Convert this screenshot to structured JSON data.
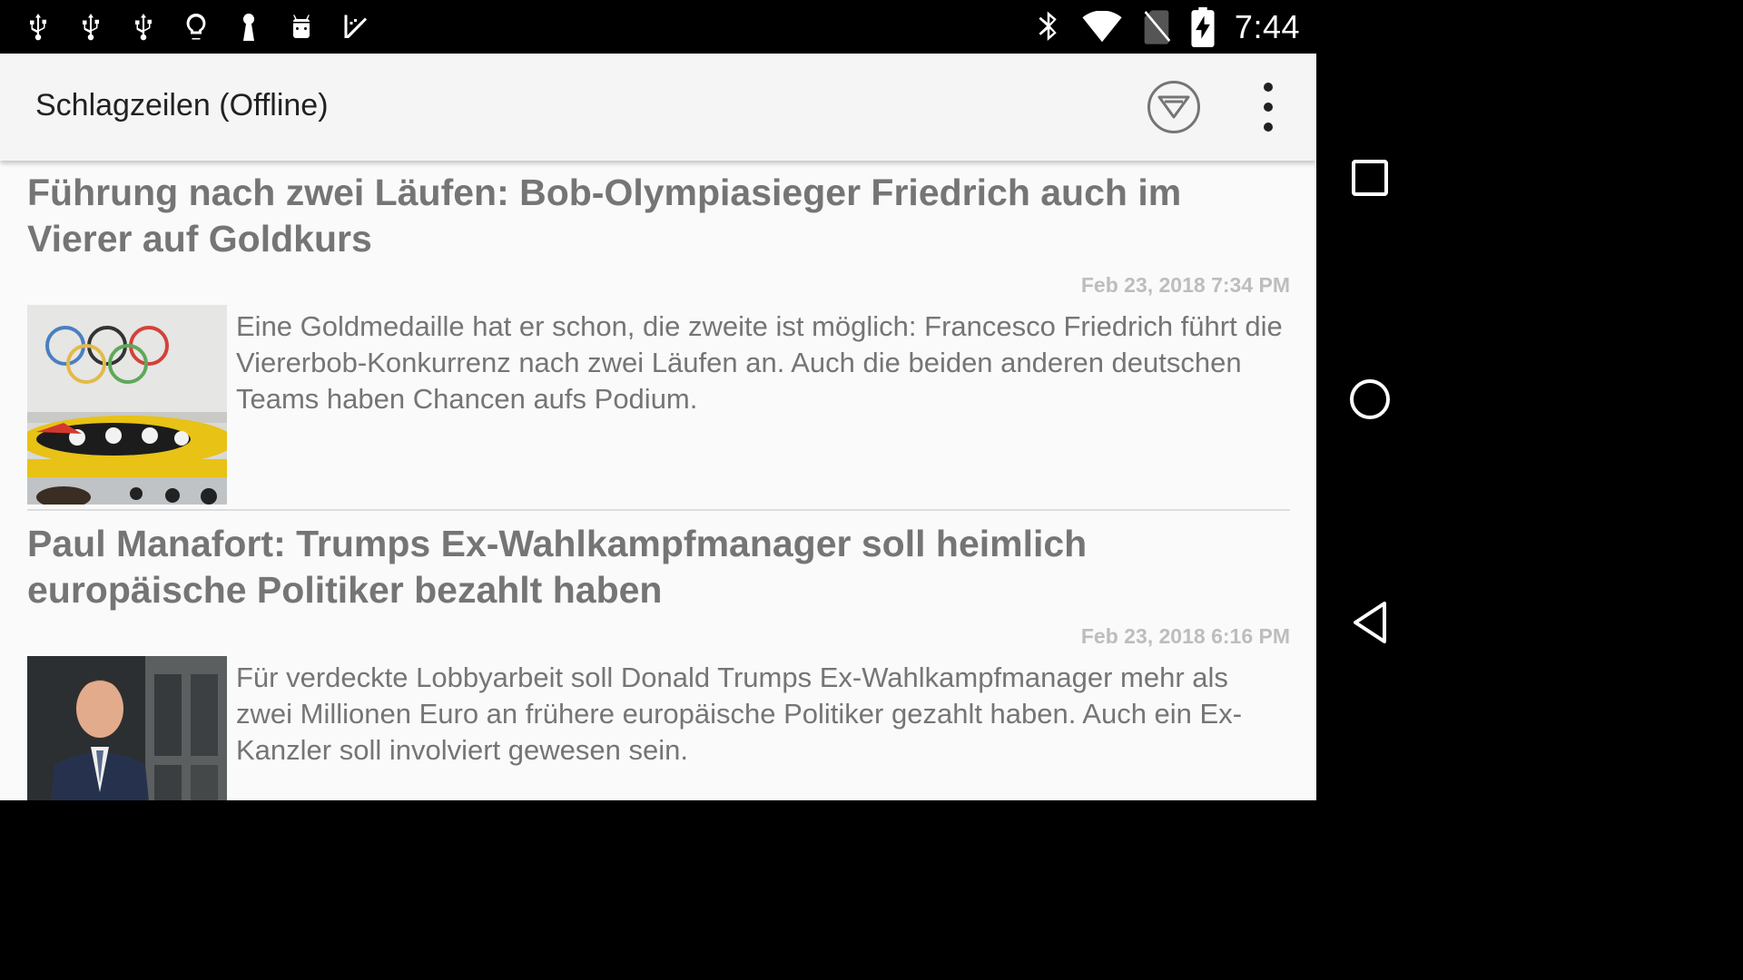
{
  "status_bar": {
    "notification_icons": [
      "usb-icon",
      "usb-icon",
      "usb-icon",
      "lightbulb-icon",
      "keyhole-icon",
      "android-icon",
      "checklist-icon"
    ],
    "system_icons": [
      "bluetooth-icon",
      "wifi-icon",
      "no-sim-icon",
      "battery-charging-icon"
    ],
    "time": "7:44"
  },
  "app_bar": {
    "title": "Schlagzeilen (Offline)",
    "filter_icon": "filter-icon",
    "overflow_icon": "more-vert-icon"
  },
  "articles": [
    {
      "headline": "Führung nach zwei Läufen: Bob-Olympiasieger Friedrich auch im Vierer auf Goldkurs",
      "timestamp": "Feb 23, 2018 7:34 PM",
      "summary": "Eine Goldmedaille hat er schon, die zweite ist möglich: Francesco Friedrich führt die Viererbob-Konkurrenz nach zwei Läufen an. Auch die beiden anderen deutschen Teams haben Chancen aufs Podium.",
      "image": "bobsled-photo"
    },
    {
      "headline": "Paul Manafort: Trumps Ex-Wahlkampfmanager soll heimlich europäische Politiker bezahlt haben",
      "timestamp": "Feb 23, 2018 6:16 PM",
      "summary": "Für verdeckte Lobbyarbeit soll Donald Trumps Ex-Wahlkampfmanager mehr als zwei Millionen Euro an frühere europäische Politiker gezahlt haben. Auch ein Ex-Kanzler soll involviert gewesen sein.",
      "image": "man-in-suit-photo"
    }
  ],
  "nav_bar": {
    "buttons": [
      "recents-icon",
      "home-icon",
      "back-icon"
    ]
  },
  "colors": {
    "status_bar_bg": "#000000",
    "app_bar_bg": "#f5f5f5",
    "content_bg": "#fafafa",
    "headline": "#757575",
    "timestamp": "#bdbdbd",
    "summary": "#757575"
  }
}
